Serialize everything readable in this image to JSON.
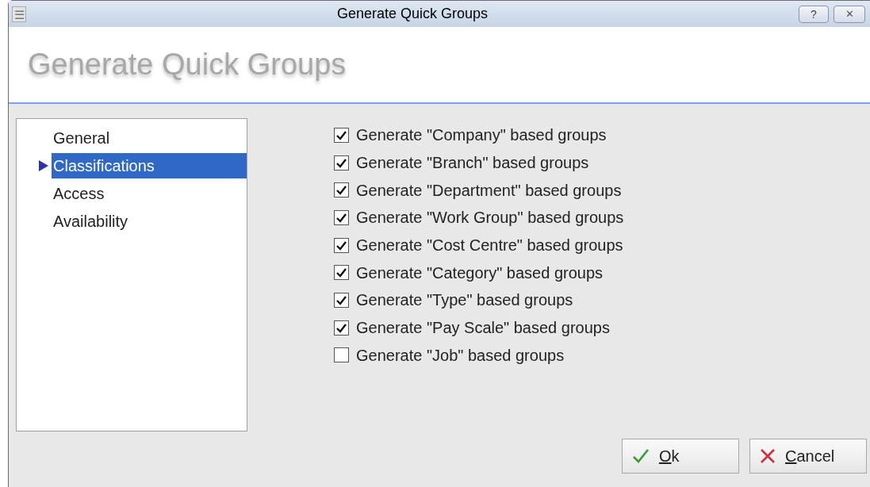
{
  "window": {
    "title": "Generate Quick Groups",
    "menu_icon": "☰",
    "help": "?",
    "close": "✕"
  },
  "header": {
    "title": "Generate Quick Groups"
  },
  "sidebar": {
    "items": [
      {
        "label": "General",
        "selected": false
      },
      {
        "label": "Classifications",
        "selected": true
      },
      {
        "label": "Access",
        "selected": false
      },
      {
        "label": "Availability",
        "selected": false
      }
    ]
  },
  "options": [
    {
      "label": "Generate \"Company\" based groups",
      "checked": true
    },
    {
      "label": "Generate \"Branch\" based groups",
      "checked": true
    },
    {
      "label": "Generate \"Department\" based groups",
      "checked": true
    },
    {
      "label": "Generate \"Work Group\" based groups",
      "checked": true
    },
    {
      "label": "Generate \"Cost Centre\" based groups",
      "checked": true
    },
    {
      "label": "Generate \"Category\" based groups",
      "checked": true
    },
    {
      "label": "Generate \"Type\" based groups",
      "checked": true
    },
    {
      "label": "Generate \"Pay Scale\" based groups",
      "checked": true
    },
    {
      "label": "Generate \"Job\" based groups",
      "checked": false
    }
  ],
  "buttons": [
    {
      "label": "Ok",
      "kind": "ok"
    },
    {
      "label": "Cancel",
      "kind": "cancel"
    }
  ]
}
